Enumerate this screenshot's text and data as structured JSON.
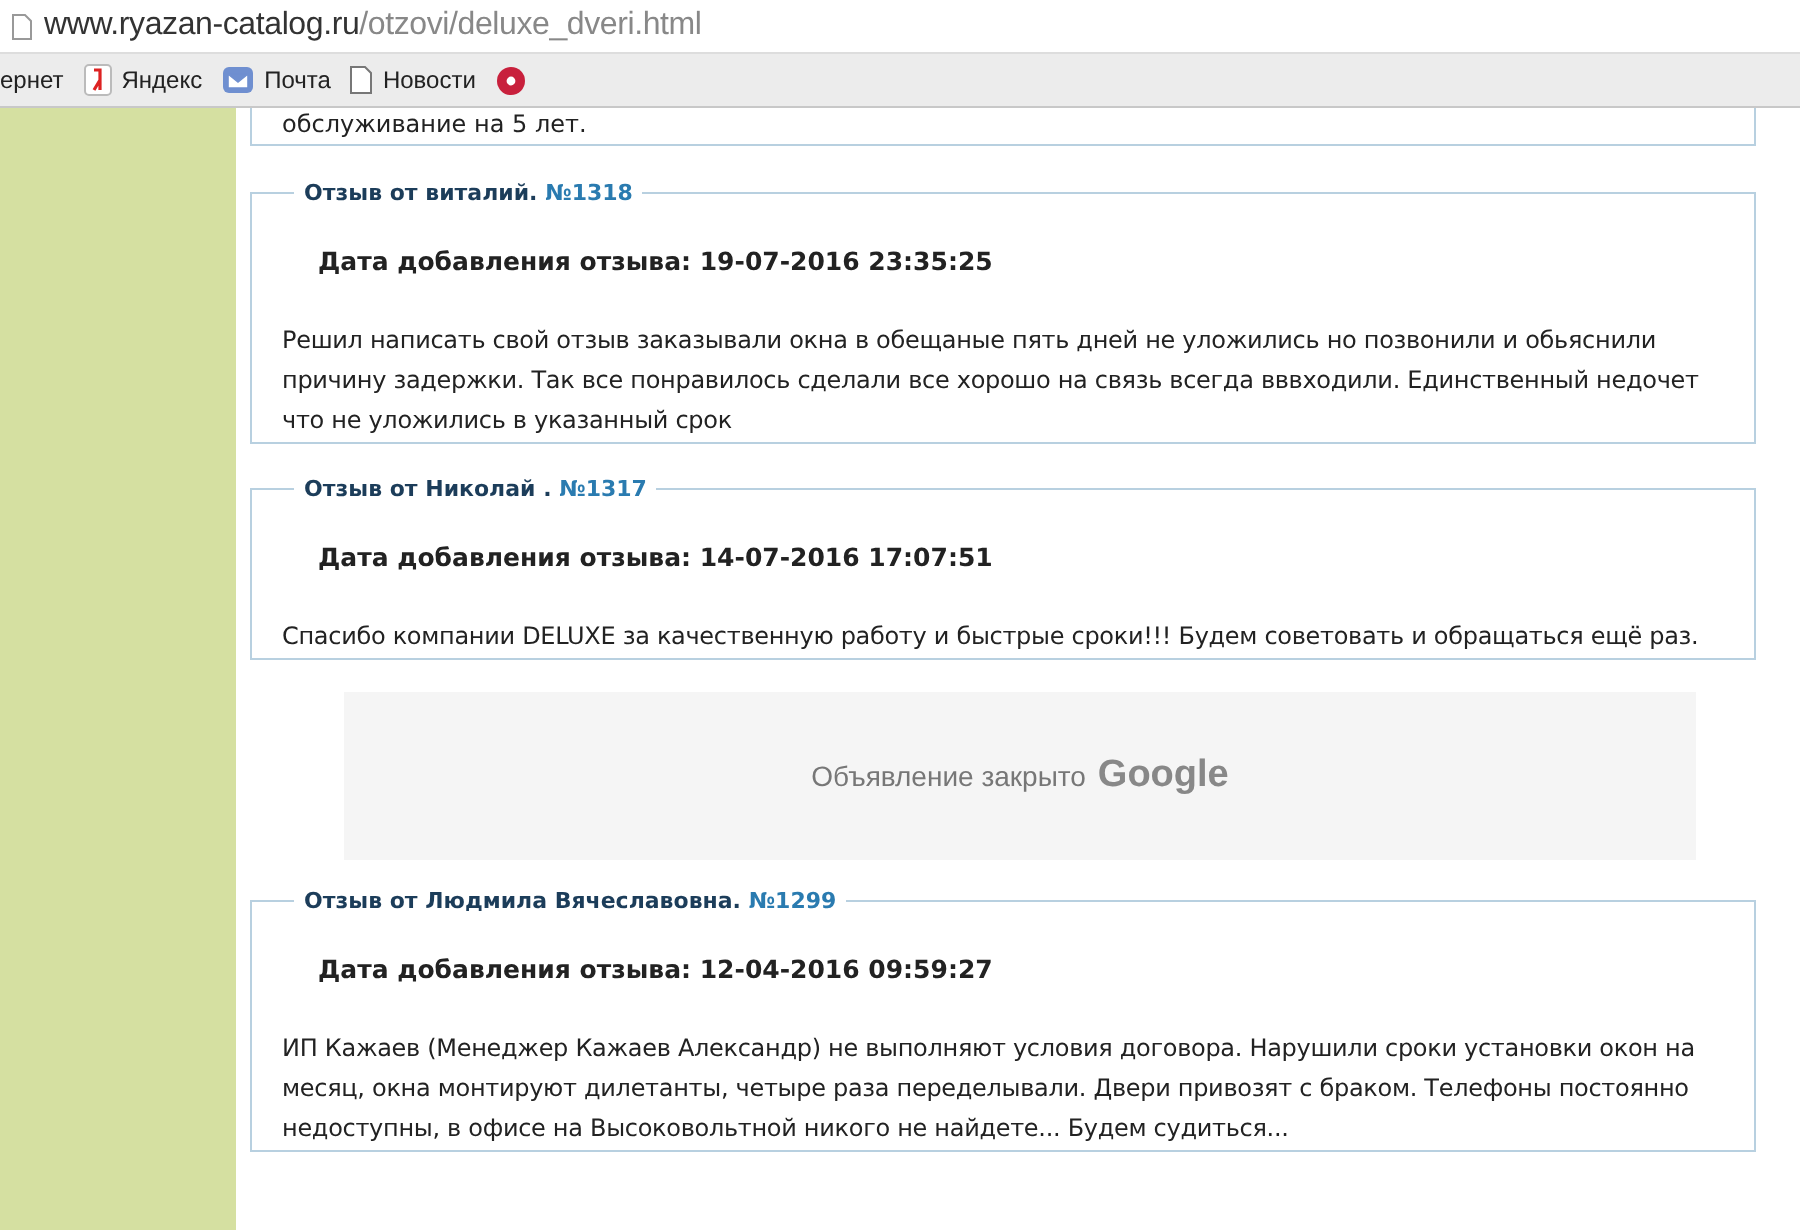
{
  "browser": {
    "url_host": "www.ryazan-catalog.ru",
    "url_path": "/otzovi/deluxe_dveri.html",
    "bookmarks": [
      {
        "kind": "text",
        "label": "ернет"
      },
      {
        "kind": "yandex",
        "label": "Яндекс"
      },
      {
        "kind": "mail",
        "label": "Почта"
      },
      {
        "kind": "page",
        "label": "Новости"
      },
      {
        "kind": "red-circle"
      }
    ]
  },
  "previous_review_tail": "обслуживание на 5 лет.",
  "reviews": [
    {
      "author_label": "Отзыв от виталий.",
      "number": "№1318",
      "date": "Дата добавления отзыва: 19-07-2016 23:35:25",
      "text": "Решил написать свой отзыв заказывали окна в обещаные пять дней не уложились но позвонили и обьяснили причину задержки. Так все понравилось сделали все хорошо на связь всегда вввходили. Единственный недочет что не уложились в указанный срок"
    },
    {
      "author_label": "Отзыв от Николай .",
      "number": "№1317",
      "date": "Дата добавления отзыва: 14-07-2016 17:07:51",
      "text": "Спасибо компании DELUXE за качественную работу и быстрые сроки!!! Будем советовать и обращаться ещё раз."
    },
    {
      "kind": "ad",
      "text": "Объявление закрыто",
      "brand": "Google"
    },
    {
      "author_label": "Отзыв от Людмила Вячеславовна.",
      "number": "№1299",
      "date": "Дата добавления отзыва: 12-04-2016 09:59:27",
      "text": "ИП Кажаев (Менеджер Кажаев Александр) не выполняют условия договора. Нарушили сроки установки окон на месяц, окна монтируют дилетанты, четыре раза переделывали. Двери привозят с браком. Телефоны постоянно недоступны, в офисе на Высоковольтной никого не найдете... Будем судиться..."
    }
  ]
}
